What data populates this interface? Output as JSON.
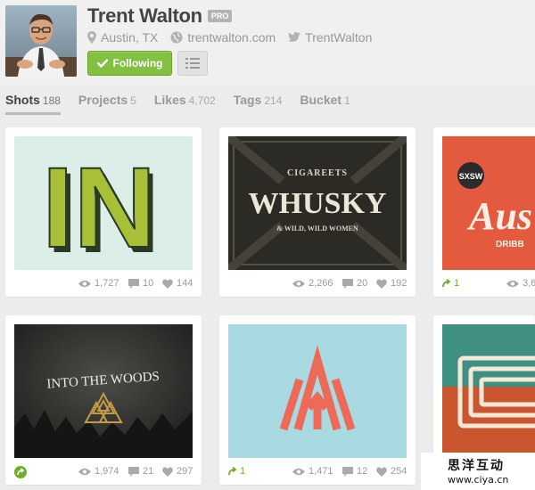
{
  "profile": {
    "name": "Trent Walton",
    "badge": "PRO",
    "location": "Austin, TX",
    "website": "trentwalton.com",
    "twitter": "TrentWalton",
    "follow_label": "Following"
  },
  "tabs": [
    {
      "label": "Shots",
      "count": "188"
    },
    {
      "label": "Projects",
      "count": "5"
    },
    {
      "label": "Likes",
      "count": "4,702"
    },
    {
      "label": "Tags",
      "count": "214"
    },
    {
      "label": "Bucket",
      "count": "1"
    }
  ],
  "shots": [
    {
      "art_text": "IN",
      "views": "1,727",
      "comments": "10",
      "likes": "144"
    },
    {
      "art_top": "CIGAREETS",
      "art_text": "WHUSKY",
      "art_sub": "& WILD, WILD WOMEN",
      "views": "2,266",
      "comments": "20",
      "likes": "192"
    },
    {
      "art_badge": "SXSW",
      "art_text": "Aus",
      "art_sub": "DRIBB",
      "rebounds": "1",
      "views": "3,6"
    },
    {
      "art_text": "INTO THE WOODS",
      "views": "1,974",
      "comments": "21",
      "likes": "297"
    },
    {
      "rebounds": "1",
      "views": "1,471",
      "comments": "12",
      "likes": "254"
    },
    {}
  ],
  "watermark": {
    "cn": "思洋互动",
    "url": "www.ciya.cn"
  },
  "colors": {
    "accent_green": "#82c042",
    "rebound_green": "#6fae2b"
  }
}
